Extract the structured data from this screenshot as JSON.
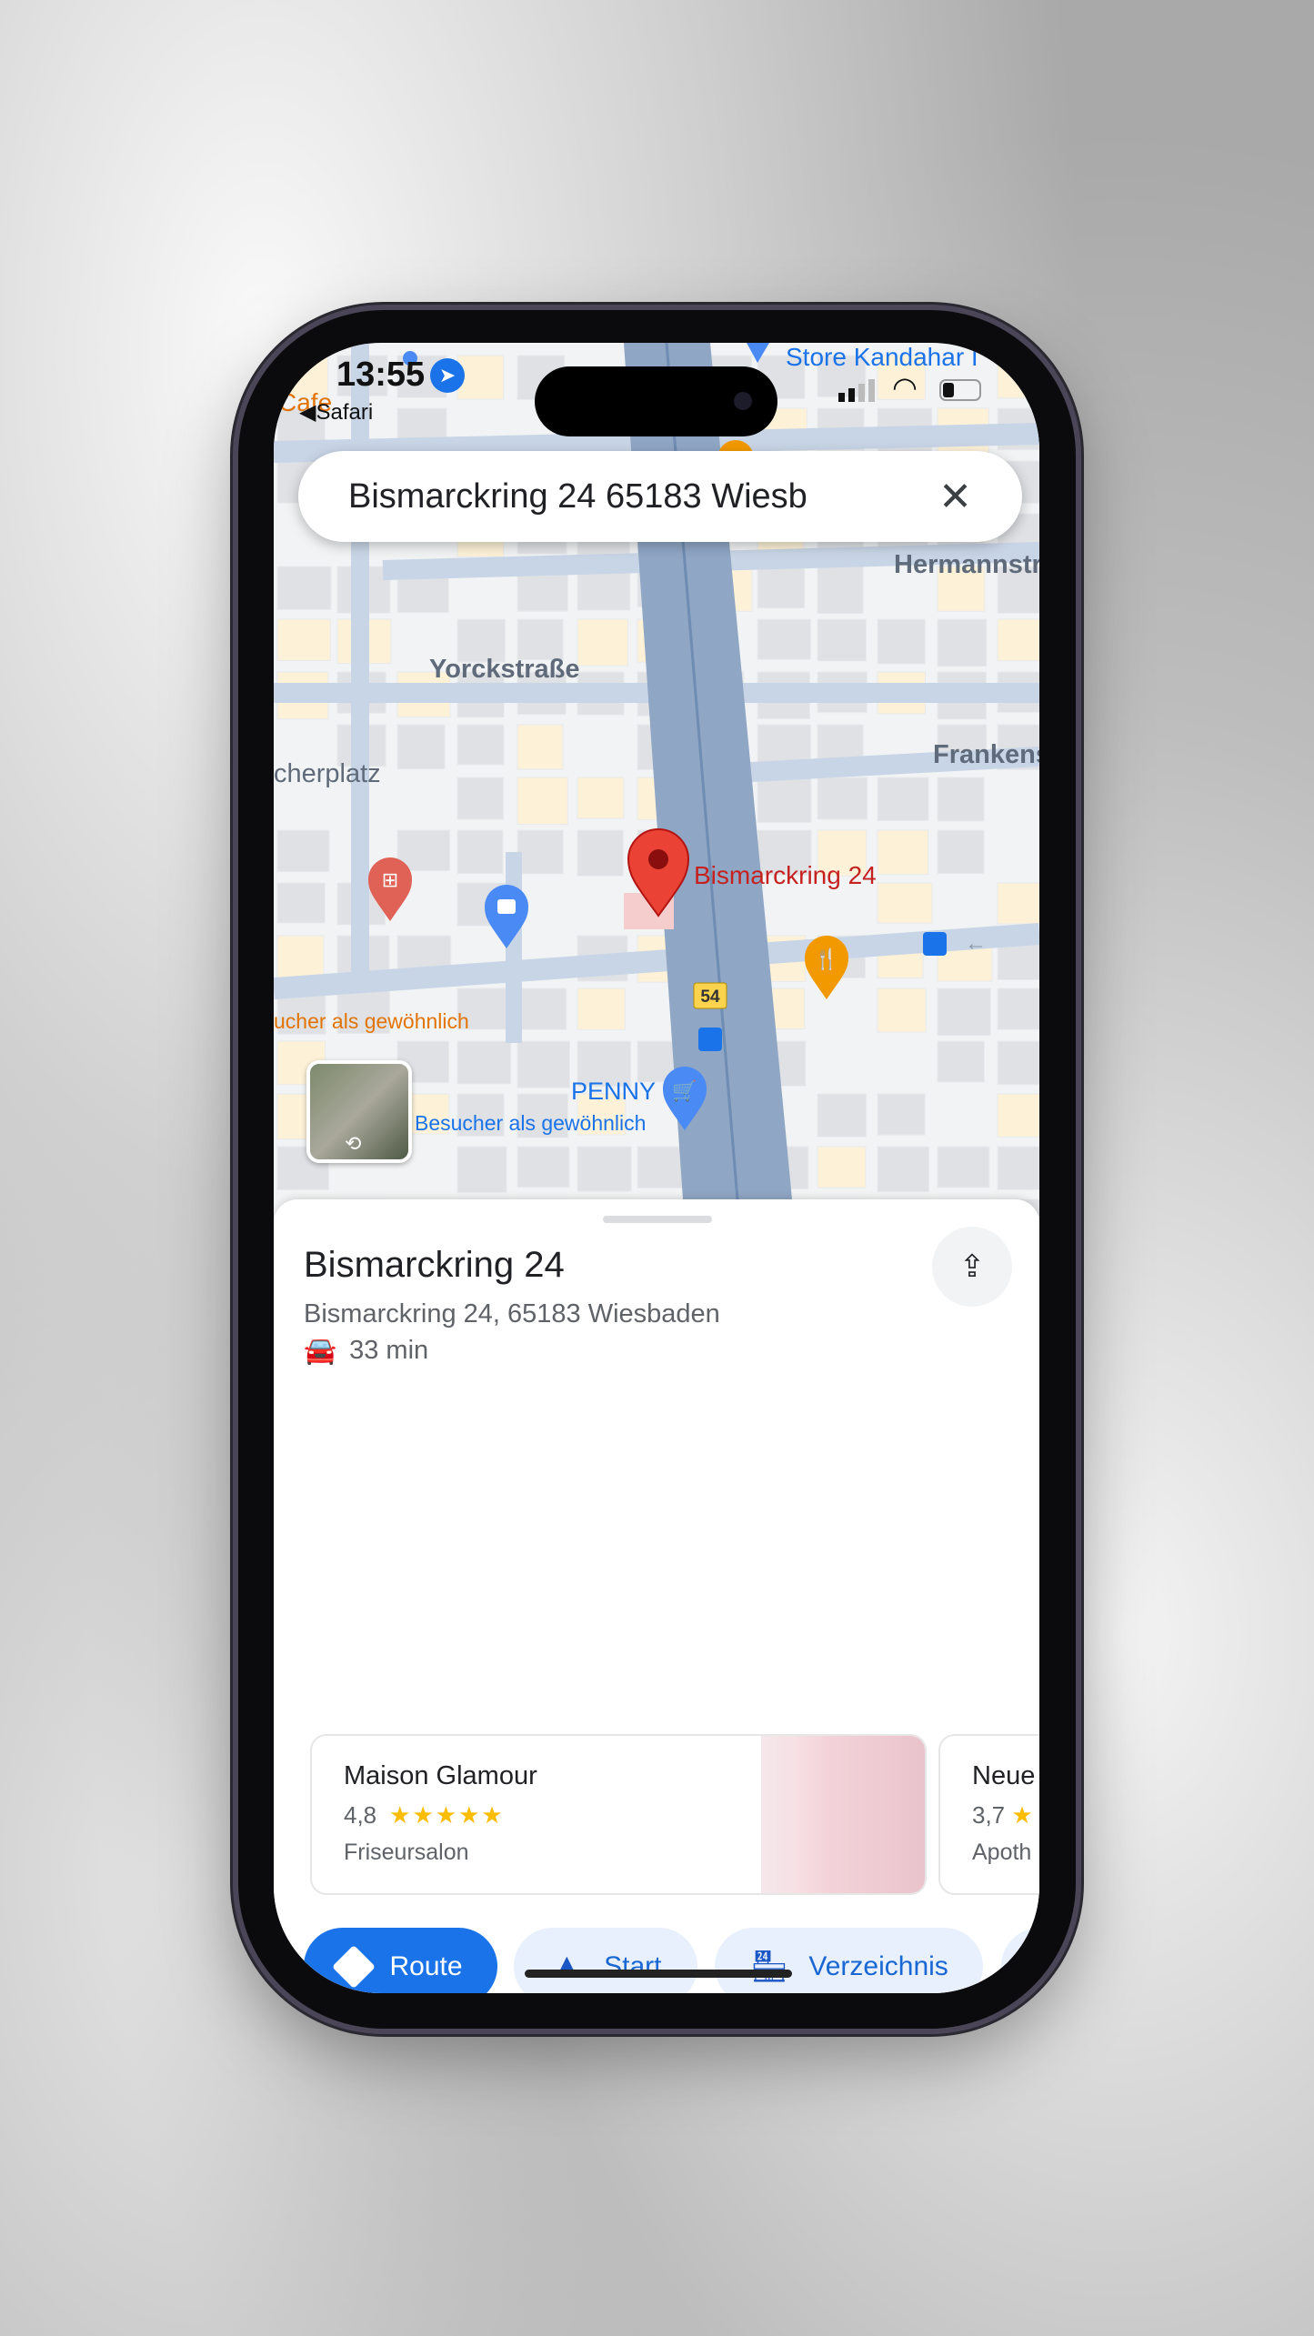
{
  "status": {
    "time": "13:55",
    "back_app": "Safari"
  },
  "search": {
    "value": "Bismarckring 24 65183 Wiesb"
  },
  "map": {
    "streets": [
      "Hermannstr.",
      "Yorckstraße",
      "Frankens",
      "cherplatz"
    ],
    "pois": {
      "store": "Store Kandahar I",
      "cafe": "Cafe",
      "penny": "PENNY",
      "penny_busy": "Besucher als gewöhnlich",
      "left_busy": "ucher als gewöhnlich",
      "pin_label": "Bismarckring 24",
      "route_shield": "54"
    }
  },
  "place": {
    "title": "Bismarckring 24",
    "address": "Bismarckring 24, 65183 Wiesbaden",
    "drive_time": "33 min"
  },
  "nearby": [
    {
      "name": "Maison Glamour",
      "rating": "4,8",
      "stars": 5,
      "category": "Friseursalon"
    },
    {
      "name": "Neue",
      "rating": "3,7",
      "category": "Apoth"
    }
  ],
  "actions": [
    {
      "label": "Route",
      "icon": "directions-icon"
    },
    {
      "label": "Start",
      "icon": "navigation-arrow-icon"
    },
    {
      "label": "Verzeichnis",
      "icon": "storefront-icon"
    }
  ],
  "colors": {
    "accent": "#1a73e8",
    "pin": "#ea4335",
    "star": "#fbbc04",
    "chip_bg": "#e8f0fe"
  }
}
